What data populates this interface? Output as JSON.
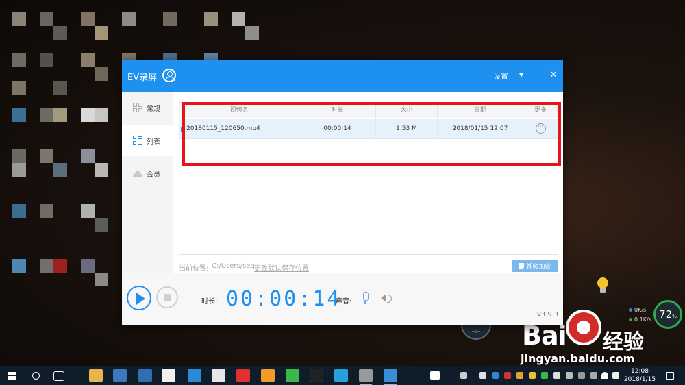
{
  "app": {
    "title": "EV录屏",
    "settings_label": "设置",
    "version": "v3.9.3"
  },
  "sidebar": {
    "items": [
      {
        "label": "常规",
        "icon": "grid-icon",
        "active": false
      },
      {
        "label": "列表",
        "icon": "list-icon",
        "active": true
      },
      {
        "label": "会员",
        "icon": "crown-icon",
        "active": false
      }
    ]
  },
  "table": {
    "headers": [
      "视频名",
      "时长",
      "大小",
      "日期",
      "更多"
    ],
    "rows": [
      {
        "name": "20180115_120650.mp4",
        "duration": "00:00:14",
        "size": "1.53 M",
        "date": "2018/01/15 12:07",
        "more": "···"
      }
    ]
  },
  "path": {
    "label": "当前位置:",
    "value": "C:/Users/seq",
    "change_link": "更改默认保存位置",
    "encrypt_button": "视频加密"
  },
  "controls": {
    "duration_label": "时长:",
    "timer": "00:00:14",
    "volume_label": "声音:"
  },
  "widgets": {
    "gauge_value": "72",
    "gauge_unit": "%",
    "net_up": "0K/s",
    "net_down": "0.1K/s",
    "rec_time": "--:--"
  },
  "watermark": {
    "baidu": "Bai",
    "jingyan": "经验",
    "url": "jingyan.baidu.com"
  },
  "taskbar": {
    "time": "12:08",
    "date": "2018/1/15"
  },
  "colors": {
    "accent": "#1e90f0",
    "highlight_box": "#e8141c",
    "row_selected": "#e6f1fb"
  }
}
